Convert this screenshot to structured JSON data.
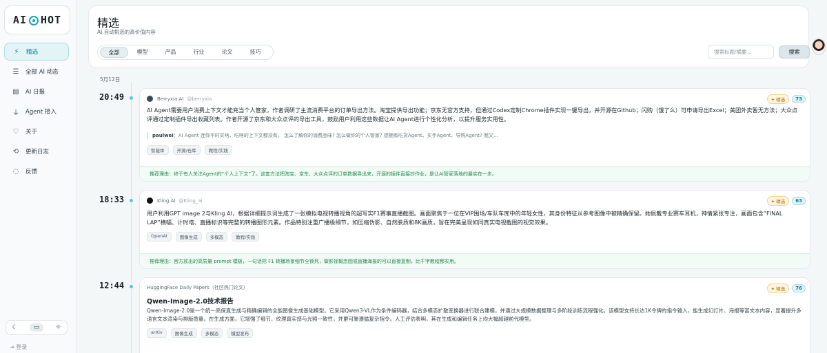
{
  "sidebar": {
    "logo": {
      "left": "AI",
      "right": "HOT"
    },
    "items": [
      {
        "label": "精选",
        "icon": "⚡",
        "icon_name": "lightning-icon"
      },
      {
        "label": "全部 AI 动态",
        "icon": "☰",
        "icon_name": "list-icon"
      },
      {
        "label": "AI 日报",
        "icon": "▤",
        "icon_name": "newspaper-icon"
      },
      {
        "label": "Agent 接入",
        "icon": "⏚",
        "icon_name": "plug-icon"
      },
      {
        "label": "关于",
        "icon": "♡",
        "icon_name": "heart-icon"
      },
      {
        "label": "更新日志",
        "icon": "⟲",
        "icon_name": "history-icon"
      },
      {
        "label": "反馈",
        "icon": "◌",
        "icon_name": "chat-bubble-icon"
      }
    ],
    "theme": {
      "dark": "☾",
      "system": "▭",
      "light": "☼"
    },
    "login": "⇥ 登录"
  },
  "header": {
    "title": "精选",
    "subtitle": "AI 自动挑选的高价值内容",
    "tabs": [
      "全部",
      "模型",
      "产品",
      "行业",
      "论文",
      "技巧"
    ],
    "search_placeholder": "搜索标题/摘要...",
    "search_button": "搜索"
  },
  "feed": {
    "date": "5月12日",
    "featured_label": "✦ 精选",
    "items": [
      {
        "time": "20:49",
        "source": "Berryxia.AI",
        "handle": "@berryxia",
        "score": "73",
        "text": "AI Agent需要用户消费上下文才能充当个人管家，作者调研了主流消费平台的订单导出方法。淘宝提供导出功能；京东无官方支持，但通过Codex定制Chrome插件实现一键导出，并开源在Github；闪购（饿了么）可申请导出Excel；美团外卖暂无方法；大众点评通过定制插件导出收藏列表。作者开源了京东和大众点评的导出工具，鼓励用户利用这些数据让AI Agent进行个性化分析，以提升服务实用性。",
        "comment_user": "paulwei",
        "comment_text": "：AI Agent 连你平时买啥、吃啥的上下文都没有。 怎么了解你的消费品味? 怎么做你的个人管家? 想拥有吃货Agent、买手Agent、导购Agent? 我又...",
        "tags": [
          "智能体",
          "开源/仓库",
          "教程/实践"
        ],
        "reason": "推荐理由：终于有人关注Agent的“个人上下文”了。这套方法把淘宝、京东、大众点评的订单数据导出来，开源的插件直接抄作业，是让AI管家落地的最实在一步。"
      },
      {
        "time": "18:33",
        "source": "Kling AI",
        "handle": "@Kling_ai",
        "score": "63",
        "text": "用户利用GPT image 2与Kling AI，根据详细提示词生成了一张模拟电视转播视角的超写实F1赛事直播截图。画面聚焦于一位在VIP围场/车队车库中的年轻女性，其身份特征从参考图像中被精确保留。她佩戴专业赛车耳机，神情紧张专注，画面包含“FINAL LAP”横幅、计时塔、直播标识等完整的转播图形元素。作品特别注重广播级细节，如压缩伪影、自然肤质和8K画质，旨在完美呈现如同真实电视截图的视觉效果。",
        "tags": [
          "OpenAI",
          "图像生成",
          "多模态",
          "教程/实践"
        ],
        "reason": "推荐理由：官方放出的高质量 prompt 模板，一句话把 F1 转播场景细节全锁死，做影视概念图或直播海报的可以直接复制，比千字教程都实用。"
      },
      {
        "time": "12:44",
        "source": "HuggingFace Daily Papers（社区热门论文）",
        "score": "76",
        "title": "Qwen-Image-2.0技术报告",
        "text": "Qwen-Image-2.0是一个统一高保真生成与精确编辑的全能图像生成基础模型。它采用Qwen3-VL作为条件编码器，结合多模态扩散变换器进行联合建模，并通过大规模数据整理与多阶段训练流程强化。该模型支持长达1K令牌的指令输入，能生成幻灯片、海报等富文本内容，显著提升多语言文本渲染与排版质量。在生成方面，它增强了细节、纹理真实感与光照一致性，并更可靠遵循复杂指令。人工评估表明，其在生成和编辑任务上均大幅超越前代模型。",
        "tags": [
          "arXiv",
          "图像生成",
          "多模态",
          "模型发布"
        ]
      }
    ]
  },
  "colors": {
    "accent": "#14a3b8",
    "featured": "#b36b00",
    "reason": "#1f8a4c"
  }
}
